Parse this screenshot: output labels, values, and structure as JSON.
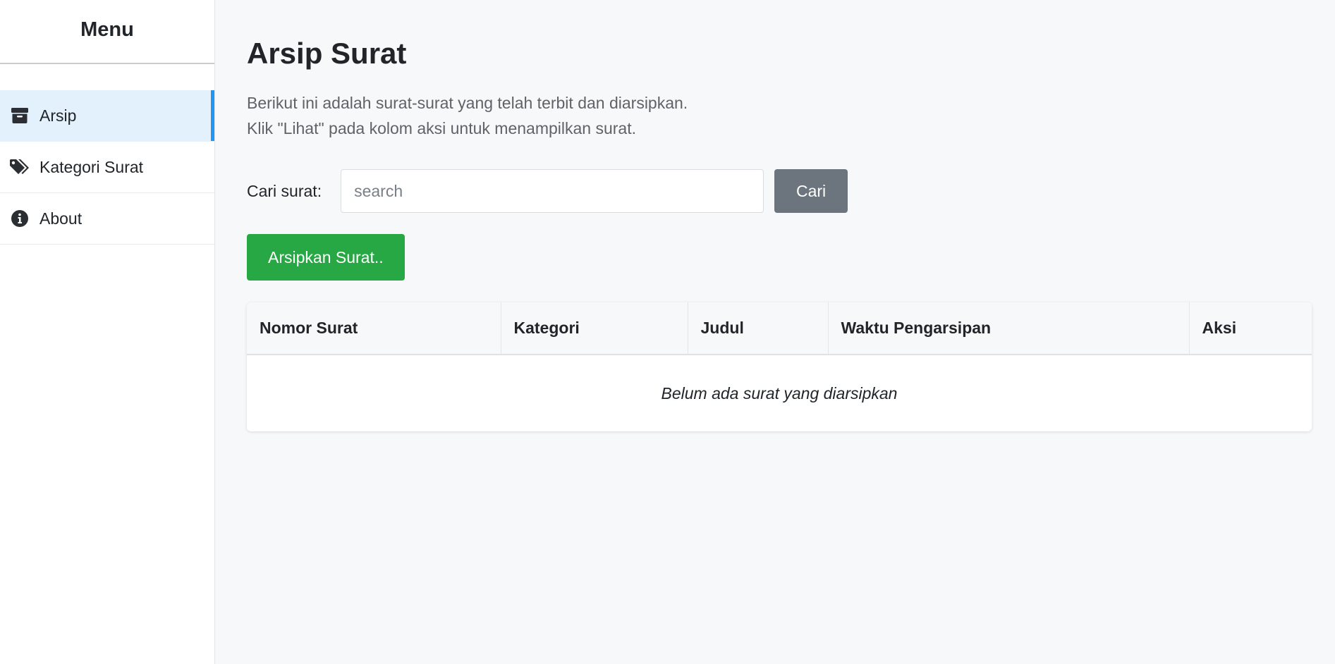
{
  "sidebar": {
    "title": "Menu",
    "items": [
      {
        "label": "Arsip",
        "icon": "archive-icon",
        "active": true
      },
      {
        "label": "Kategori Surat",
        "icon": "tags-icon",
        "active": false
      },
      {
        "label": "About",
        "icon": "info-circle-icon",
        "active": false
      }
    ],
    "active_color": "#2196f3",
    "active_bg": "#e3f1fc"
  },
  "main": {
    "title": "Arsip Surat",
    "description": [
      "Berikut ini adalah surat-surat yang telah terbit dan diarsipkan.",
      "Klik \"Lihat\" pada kolom aksi untuk menampilkan surat."
    ],
    "search": {
      "label": "Cari surat:",
      "placeholder": "search",
      "value": "",
      "button_label": "Cari",
      "button_color": "#6c757d"
    },
    "archive_button": {
      "label": "Arsipkan Surat..",
      "color": "#28a745"
    },
    "table": {
      "columns": [
        "Nomor Surat",
        "Kategori",
        "Judul",
        "Waktu Pengarsipan",
        "Aksi"
      ],
      "rows": [],
      "empty_message": "Belum ada surat yang diarsipkan"
    }
  }
}
